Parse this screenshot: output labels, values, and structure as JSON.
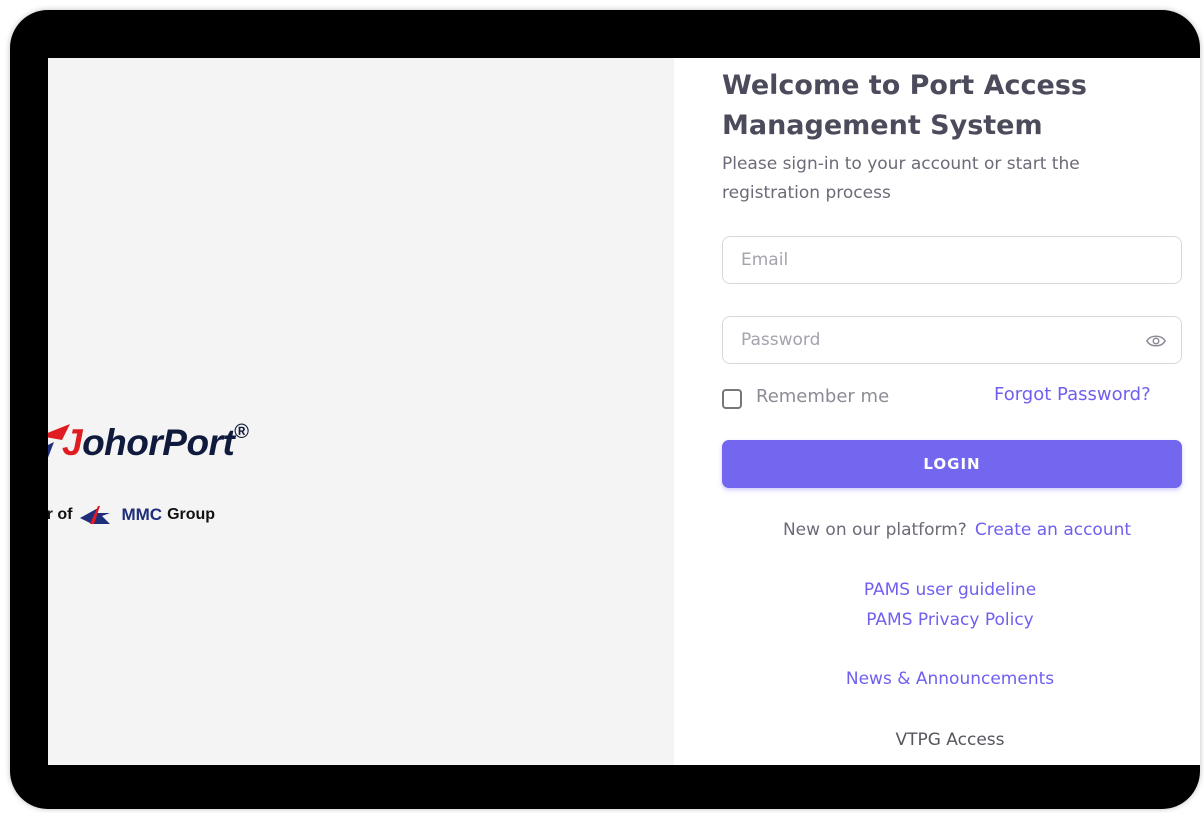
{
  "branding": {
    "logo_letter": "J",
    "logo_rest": "ohorPort",
    "registered_mark": "®",
    "member_prefix": "ber of",
    "member_group": "MMC",
    "member_suffix": "Group",
    "colors": {
      "red": "#e11b22",
      "navy": "#1f2e7a"
    }
  },
  "login": {
    "title": "Welcome to Port Access Management System",
    "subtitle": "Please sign-in to your account or start the registration process",
    "email_placeholder": "Email",
    "password_placeholder": "Password",
    "password_toggle_icon": "eye-icon",
    "remember_label": "Remember me",
    "forgot_label": "Forgot Password?",
    "login_label": "LOGIN",
    "accent_color": "#7367f0"
  },
  "signup": {
    "prompt": "New on our platform?",
    "link": "Create an account"
  },
  "links": {
    "guideline": "PAMS user guideline",
    "privacy": "PAMS Privacy Policy",
    "news": "News & Announcements",
    "vtpg": "VTPG Access"
  }
}
